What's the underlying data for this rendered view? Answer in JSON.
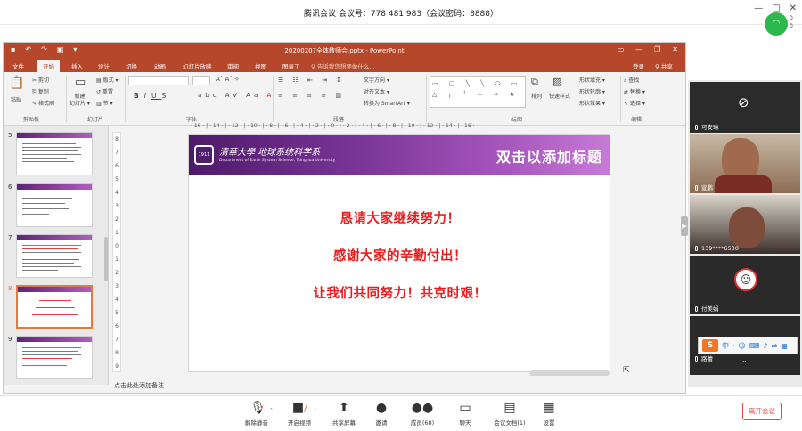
{
  "meeting": {
    "title": "腾讯会议  会议号：778 481 983（会议密码：8888）",
    "wifi_text": "0\n0"
  },
  "ppt": {
    "window_title": "20200207全体教师会.pptx - PowerPoint",
    "menus": [
      "文件",
      "开始",
      "插入",
      "设计",
      "切换",
      "动画",
      "幻灯片放映",
      "审阅",
      "视图",
      "图表工",
      "♀ 告诉我您想要做什么..."
    ],
    "active_menu": "开始",
    "login": "登录",
    "share": "♀ 共享",
    "ribbon": {
      "paste": "粘贴",
      "cut": "剪切",
      "copy": "复制",
      "format_painter": "格式刷",
      "new_slide": "新建\n幻灯片 ▾",
      "layout": "版式 ▾",
      "reset": "重置",
      "section": "节 ▾",
      "text_direction": "文字方向 ▾",
      "align_text": "对齐文本 ▾",
      "smartart": "转换为 SmartArt ▾",
      "arrange": "排列",
      "quick_styles": "快速样式",
      "shape_fill": "形状填充 ▾",
      "shape_outline": "形状轮廓 ▾",
      "shape_effects": "形状效果 ▾",
      "find": "查找",
      "replace": "替换 ▾",
      "select": "选择 ▾",
      "groups": [
        "剪贴板",
        "幻灯片",
        "字体",
        "段落",
        "绘图",
        "编辑"
      ]
    },
    "hruler": "· 16 · | · 14 · | · 12 · | · 10 · | · 8 · | · 6 · | · 4 · | · 2 · | · 0 · | · 2 · | · 4 · | · 6 · | · 8 · | · 10 · | · 12 · | · 14 · | · 16 ·",
    "vruler": [
      "8",
      "7",
      "6",
      "5",
      "4",
      "3",
      "2",
      "1",
      "0",
      "1",
      "2",
      "3",
      "4",
      "5",
      "6",
      "7",
      "8",
      "9"
    ],
    "thumbs": [
      {
        "num": "5"
      },
      {
        "num": "6"
      },
      {
        "num": "7"
      },
      {
        "num": "8",
        "selected": true
      },
      {
        "num": "9"
      }
    ],
    "slide": {
      "univ_cn": "清華大學 地球系统科学系",
      "univ_en": "Department of Earth System Science, Tsinghua University",
      "logo": "1911",
      "heading": "双击以添加标题",
      "lines": [
        "恳请大家继续努力！",
        "感谢大家的辛勤付出！",
        "让我们共同努力！共克时艰！"
      ]
    },
    "notes": "点击此处添加备注"
  },
  "participants": [
    {
      "name": "可安琳",
      "video": false
    },
    {
      "name": "宣鹏",
      "video": true
    },
    {
      "name": "139****6530",
      "video": true
    },
    {
      "name": "付美娟",
      "video": false
    },
    {
      "name": "路蕾",
      "video": false
    }
  ],
  "ime": [
    "中",
    "·",
    "☺",
    "⌨",
    "♪",
    "⇌",
    "▦"
  ],
  "toolbar": {
    "items": [
      {
        "label": "解除静音",
        "icon": "mic-muted-icon",
        "glyph": "🎙"
      },
      {
        "label": "开启视频",
        "icon": "camera-off-icon",
        "glyph": "▶"
      },
      {
        "label": "共享屏幕",
        "icon": "share-screen-icon",
        "glyph": "⬆"
      },
      {
        "label": "邀请",
        "icon": "invite-icon",
        "glyph": "👤"
      },
      {
        "label": "成员(68)",
        "icon": "members-icon",
        "glyph": "👥"
      },
      {
        "label": "聊天",
        "icon": "chat-icon",
        "glyph": "💬"
      },
      {
        "label": "会议文档(1)",
        "icon": "document-icon",
        "glyph": "▤"
      },
      {
        "label": "设置",
        "icon": "settings-icon",
        "glyph": "⚙"
      }
    ],
    "leave": "离开会议"
  },
  "colors": {
    "ppt_accent": "#b7472a",
    "slide_text": "#e81e1e",
    "banner": "#7a3596",
    "leave": "#e24b42"
  }
}
